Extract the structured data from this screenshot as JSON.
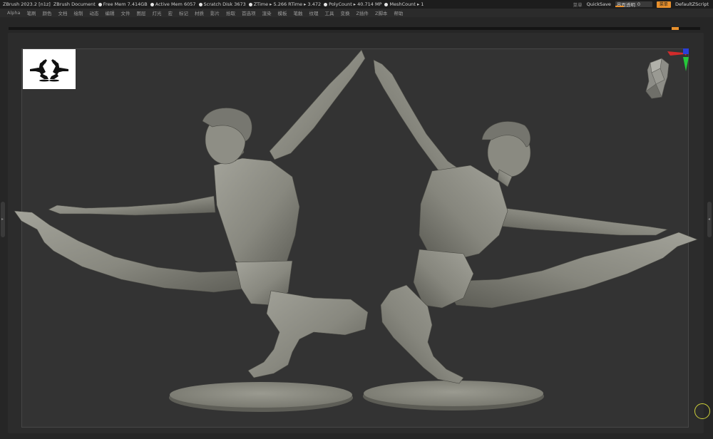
{
  "titlebar": {
    "app": "ZBrush 2023.2 [n1z]",
    "doc": "ZBrush Document",
    "stats": [
      {
        "label": "Free Mem 7.414GB"
      },
      {
        "label": "Active Mem 6057"
      },
      {
        "label": "Scratch Disk 3673"
      },
      {
        "label": "ZTime ▸ 5.266 RTime ▸ 3.472"
      },
      {
        "label": "PolyCount ▸ 40.714 MP"
      },
      {
        "label": "MeshCount ▸ 1"
      }
    ],
    "right": {
      "label_muted": "菜单",
      "quicksave": "QuickSave",
      "opacity_label": "界面透明",
      "opacity_value": "0",
      "menus_button": "菜单",
      "script": "DefaultZScript"
    }
  },
  "menubar": {
    "items": [
      "Alpha",
      "笔刷",
      "颜色",
      "文档",
      "绘制",
      "动态",
      "编辑",
      "文件",
      "图层",
      "灯光",
      "宏",
      "标记",
      "材质",
      "影片",
      "拾取",
      "首选项",
      "渲染",
      "模板",
      "笔触",
      "纹理",
      "工具",
      "变换",
      "Z插件",
      "Z脚本",
      "帮助"
    ]
  },
  "colors": {
    "accent": "#e8902c",
    "clay": "#8c8c83",
    "canvas": "#333333"
  },
  "icons": {
    "thumbnail": "dancer-silhouette-thumbnail",
    "gizmo": "head-navigation-gizmo",
    "corner": "rotation-ring-icon"
  }
}
